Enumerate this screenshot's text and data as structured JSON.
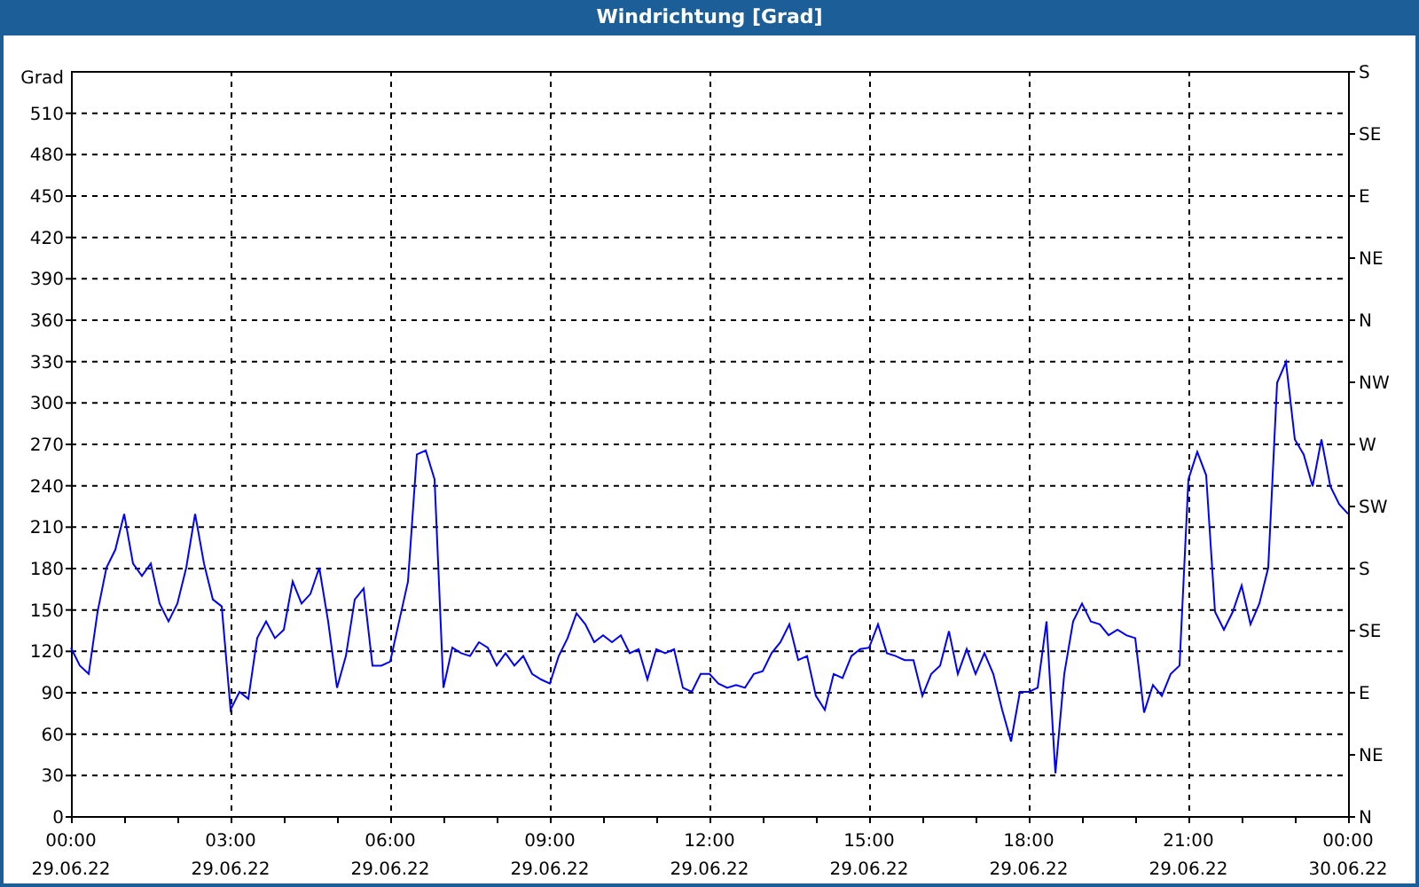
{
  "window": {
    "title": "Windrichtung [Grad]"
  },
  "chart": {
    "chart_data": {
      "type": "line",
      "ylabel": "Grad",
      "ylim": [
        0,
        540
      ],
      "yticks": [
        0,
        30,
        60,
        90,
        120,
        150,
        180,
        210,
        240,
        270,
        300,
        330,
        360,
        390,
        420,
        450,
        480,
        510
      ],
      "grid": true,
      "annotations": [
        "N",
        "NE",
        "E",
        "SE",
        "S",
        "SW",
        "W",
        "NW",
        "N",
        "NE",
        "E",
        "SE",
        "S"
      ],
      "categories": [
        "00:00 29.06.22",
        null,
        null,
        null,
        null,
        null,
        null,
        null,
        null,
        null,
        null,
        null,
        null,
        null,
        null,
        null,
        null,
        null,
        "03:00 29.06.22",
        null,
        null,
        null,
        null,
        null,
        null,
        null,
        null,
        null,
        null,
        null,
        null,
        null,
        null,
        null,
        null,
        null,
        "06:00 29.06.22",
        null,
        null,
        null,
        null,
        null,
        null,
        null,
        null,
        null,
        null,
        null,
        null,
        null,
        null,
        null,
        null,
        null,
        "09:00 29.06.22",
        null,
        null,
        null,
        null,
        null,
        null,
        null,
        null,
        null,
        null,
        null,
        null,
        null,
        null,
        null,
        null,
        null,
        "12:00 29.06.22",
        null,
        null,
        null,
        null,
        null,
        null,
        null,
        null,
        null,
        null,
        null,
        null,
        null,
        null,
        null,
        null,
        null,
        "15:00 29.06.22",
        null,
        null,
        null,
        null,
        null,
        null,
        null,
        null,
        null,
        null,
        null,
        null,
        null,
        null,
        null,
        null,
        null,
        "18:00 29.06.22",
        null,
        null,
        null,
        null,
        null,
        null,
        null,
        null,
        null,
        null,
        null,
        null,
        null,
        null,
        null,
        null,
        null,
        "21:00 29.06.22",
        null,
        null,
        null,
        null,
        null,
        null,
        null,
        null,
        null,
        null,
        null,
        null,
        null,
        null,
        null,
        null,
        null,
        "00:00 30.06.22"
      ],
      "series": [
        {
          "color": "#0000ff",
          "values": [
            122,
            109,
            103,
            148,
            180,
            193,
            219,
            183,
            174,
            183,
            154,
            141,
            154,
            180,
            219,
            183,
            157,
            152,
            77,
            90,
            85,
            129,
            141,
            129,
            135,
            170,
            154,
            161,
            180,
            141,
            93,
            116,
            157,
            165,
            109,
            109,
            112,
            141,
            170,
            262,
            265,
            244,
            93,
            122,
            118,
            116,
            126,
            122,
            109,
            118,
            109,
            116,
            103,
            99,
            96,
            116,
            129,
            147,
            139,
            126,
            131,
            126,
            131,
            118,
            121,
            99,
            121,
            118,
            121,
            93,
            90,
            103,
            103,
            96,
            93,
            95,
            93,
            103,
            105,
            118,
            126,
            139,
            113,
            116,
            87,
            77,
            103,
            100,
            116,
            121,
            122,
            139,
            118,
            116,
            113,
            113,
            87,
            103,
            109,
            134,
            103,
            121,
            103,
            118,
            103,
            77,
            54,
            90,
            90,
            93,
            141,
            31,
            103,
            141,
            154,
            141,
            139,
            131,
            135,
            131,
            129,
            75,
            95,
            87,
            103,
            109,
            244,
            264,
            247,
            148,
            135,
            148,
            167,
            139,
            154,
            180,
            314,
            329,
            273,
            262,
            239,
            273,
            239,
            226,
            219
          ]
        }
      ]
    }
  }
}
